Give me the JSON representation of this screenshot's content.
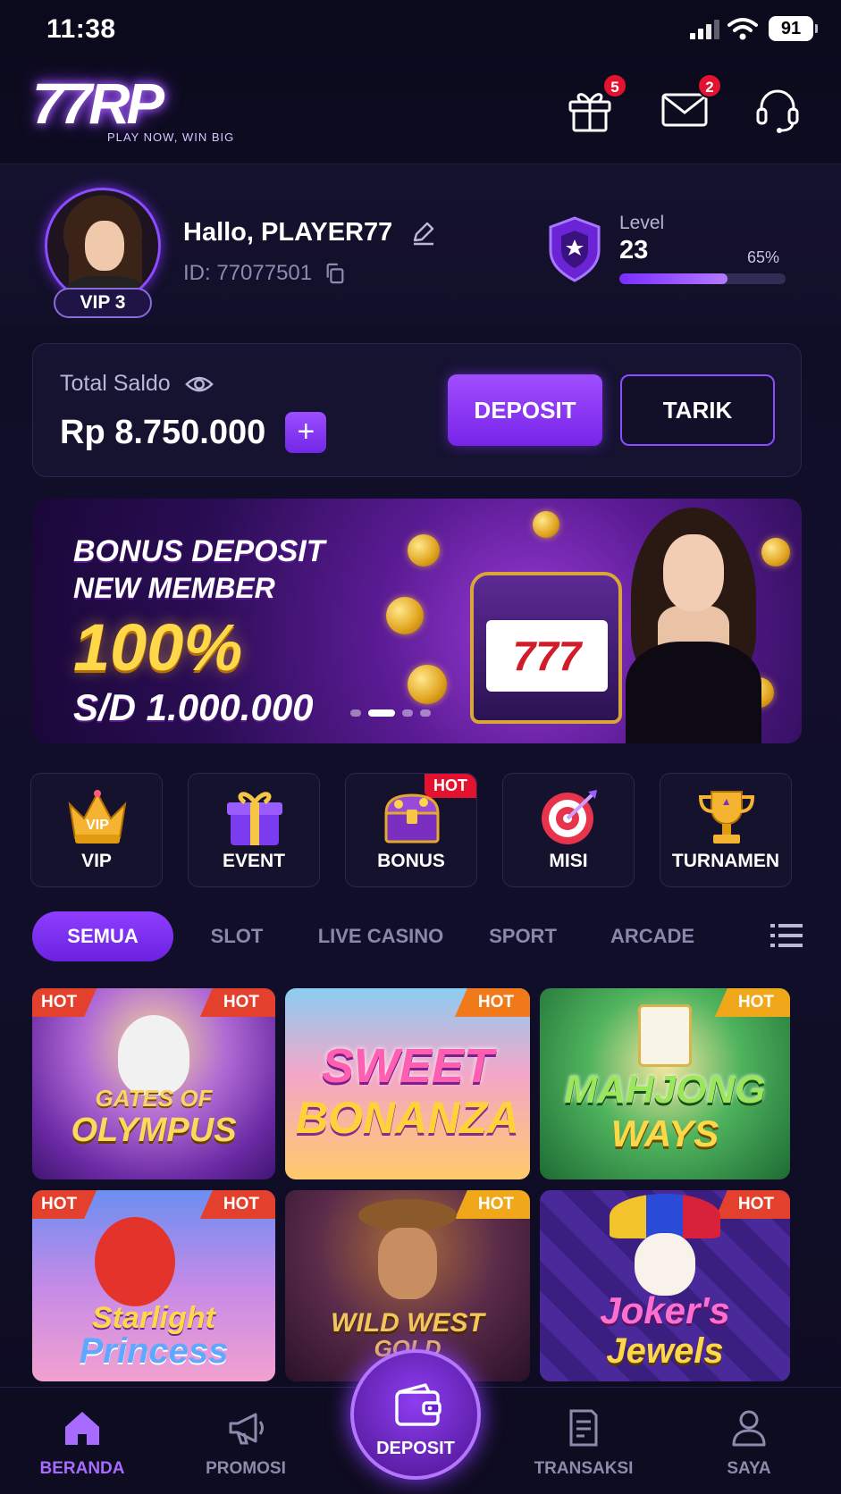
{
  "status": {
    "time": "11:38",
    "battery": "91"
  },
  "header": {
    "logo_text": "77RP",
    "logo_tagline": "PLAY NOW, WIN BIG",
    "gift_badge": "5",
    "mail_badge": "2"
  },
  "profile": {
    "greeting": "Hallo, PLAYER77",
    "id": "ID: 77077501",
    "vip": "VIP 3",
    "level_label": "Level",
    "level": "23",
    "progress_text": "65%",
    "progress": 0.65
  },
  "balance": {
    "label": "Total Saldo",
    "amount": "Rp 8.750.000",
    "plus": "+",
    "deposit": "DEPOSIT",
    "withdraw": "TARIK"
  },
  "banner": {
    "line1": "BONUS DEPOSIT",
    "line2": "NEW MEMBER",
    "line3": "100%",
    "line4": "S/D 1.000.000",
    "slot_reels": "777"
  },
  "categories": [
    {
      "label": "VIP",
      "icon": "crown-icon"
    },
    {
      "label": "EVENT",
      "icon": "gift-box-icon"
    },
    {
      "label": "BONUS",
      "icon": "treasure-chest-icon",
      "badge": "HOT"
    },
    {
      "label": "MISI",
      "icon": "target-icon"
    },
    {
      "label": "TURNAMEN",
      "icon": "trophy-icon"
    }
  ],
  "tabs": [
    "SEMUA",
    "SLOT",
    "LIVE CASINO",
    "SPORT",
    "ARCADE"
  ],
  "games": [
    {
      "title_line1": "GATES OF",
      "title_line2": "OLYMPUS",
      "badge": "HOT",
      "corner": "HOT"
    },
    {
      "title_line1": "SWEET",
      "title_line2": "BONANZA",
      "badge": "HOT"
    },
    {
      "title_line1": "MAHJONG",
      "title_line2": "WAYS",
      "badge": "HOT"
    },
    {
      "title_line1": "Starlight",
      "title_line2": "Princess",
      "badge": "HOT",
      "corner": "HOT"
    },
    {
      "title_line1": "WILD WEST",
      "title_line2": "GOLD",
      "badge": "HOT"
    },
    {
      "title_line1": "Joker's",
      "title_line2": "Jewels",
      "badge": "HOT"
    }
  ],
  "nav": {
    "home": "BERANDA",
    "promo": "PROMOSI",
    "deposit": "DEPOSIT",
    "transactions": "TRANSAKSI",
    "me": "SAYA"
  },
  "colors": {
    "accent": "#8b3dff",
    "hot": "#e3122e",
    "gold": "#ffd84a"
  }
}
